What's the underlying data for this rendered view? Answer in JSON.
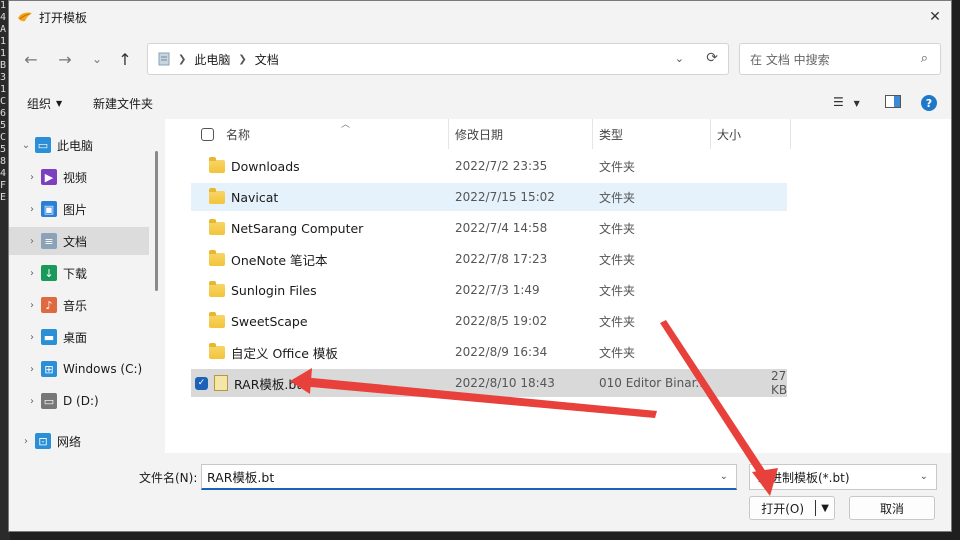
{
  "background_strip": [
    "1",
    "4",
    "A",
    "1",
    "1",
    "B",
    "3",
    "1",
    "C",
    "6",
    "5",
    "C",
    "5",
    "8",
    "4",
    "F",
    "E"
  ],
  "dialog": {
    "title": "打开模板",
    "close_glyph": "✕"
  },
  "nav": {
    "back_glyph": "←",
    "forward_glyph": "→",
    "recent_glyph": "⌄",
    "up_glyph": "↑",
    "breadcrumb": [
      "此电脑",
      "文档"
    ],
    "search_placeholder": "在 文档 中搜索"
  },
  "toolbar": {
    "organize_label": "组织",
    "new_folder_label": "新建文件夹"
  },
  "sidebar": {
    "items": [
      {
        "label": "此电脑",
        "icon": "computer-icon",
        "color": "#2a8fd6"
      },
      {
        "label": "视频",
        "icon": "video-icon",
        "color": "#7b3fbf"
      },
      {
        "label": "图片",
        "icon": "picture-icon",
        "color": "#2a7fd6"
      },
      {
        "label": "文档",
        "icon": "document-icon",
        "color": "#8aa3b8"
      },
      {
        "label": "下载",
        "icon": "download-icon",
        "color": "#1a9a5a"
      },
      {
        "label": "音乐",
        "icon": "music-icon",
        "color": "#e06a40"
      },
      {
        "label": "桌面",
        "icon": "desktop-icon",
        "color": "#2a8fd6"
      },
      {
        "label": "Windows (C:)",
        "icon": "windows-drive-icon",
        "color": "#2a8fd6"
      },
      {
        "label": "D (D:)",
        "icon": "drive-icon",
        "color": "#777777"
      },
      {
        "label": "网络",
        "icon": "network-icon",
        "color": "#2a8fd6"
      }
    ]
  },
  "columns": {
    "name": "名称",
    "modified": "修改日期",
    "type": "类型",
    "size": "大小"
  },
  "files": [
    {
      "name": "Downloads",
      "modified": "2022/7/2 23:35",
      "type": "文件夹",
      "size": ""
    },
    {
      "name": "Navicat",
      "modified": "2022/7/15 15:02",
      "type": "文件夹",
      "size": ""
    },
    {
      "name": "NetSarang Computer",
      "modified": "2022/7/4 14:58",
      "type": "文件夹",
      "size": ""
    },
    {
      "name": "OneNote 笔记本",
      "modified": "2022/7/8 17:23",
      "type": "文件夹",
      "size": ""
    },
    {
      "name": "Sunlogin Files",
      "modified": "2022/7/3 1:49",
      "type": "文件夹",
      "size": ""
    },
    {
      "name": "SweetScape",
      "modified": "2022/8/5 19:02",
      "type": "文件夹",
      "size": ""
    },
    {
      "name": "自定义 Office 模板",
      "modified": "2022/8/9 16:34",
      "type": "文件夹",
      "size": ""
    },
    {
      "name": "RAR模板.bt",
      "modified": "2022/8/10 18:43",
      "type": "010 Editor Binar...",
      "size": "27 KB"
    }
  ],
  "bottom": {
    "filename_label": "文件名(N):",
    "filename_value": "RAR模板.bt",
    "filter_value": "二进制模板(*.bt)",
    "open_label": "打开(O)",
    "cancel_label": "取消"
  },
  "colors": {
    "accent": "#1c62b9",
    "annotation_arrow": "#e8403a"
  }
}
